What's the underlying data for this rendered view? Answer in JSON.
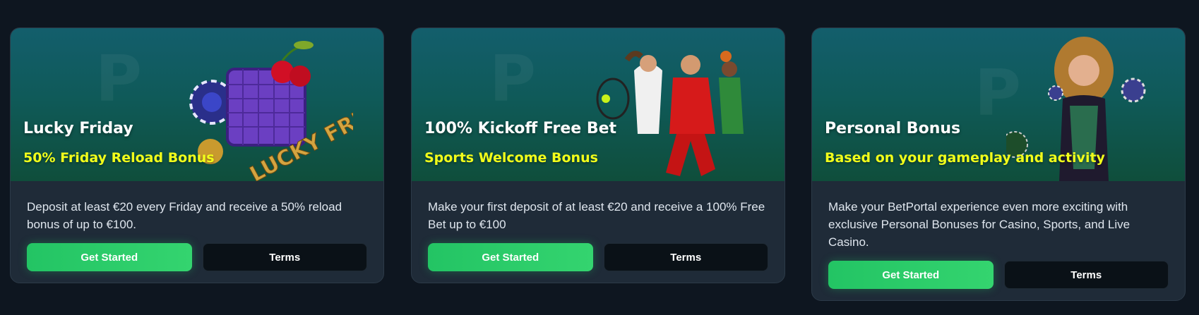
{
  "colors": {
    "page_bg": "#0e1620",
    "card_bg": "#1f2b38",
    "accent_green": "#23c464",
    "subtitle_yellow": "#f2ff1a"
  },
  "promos": [
    {
      "title": "Lucky Friday",
      "subtitle": "50% Friday Reload Bonus",
      "description": "Deposit at least €20 every Friday and receive a 50% reload bonus of up to €100.",
      "primary_label": "Get Started",
      "secondary_label": "Terms",
      "art_text": "LUCKY FRIDAY"
    },
    {
      "title": "100% Kickoff Free Bet",
      "subtitle": "Sports Welcome Bonus",
      "description": "Make your first deposit of at least €20 and receive a 100% Free Bet up to €100",
      "primary_label": "Get Started",
      "secondary_label": "Terms"
    },
    {
      "title": "Personal Bonus",
      "subtitle": "Based on your gameplay and activity",
      "description": "Make your BetPortal experience even more exciting with exclusive Personal Bonuses for Casino, Sports, and Live Casino.",
      "primary_label": "Get Started",
      "secondary_label": "Terms"
    }
  ]
}
